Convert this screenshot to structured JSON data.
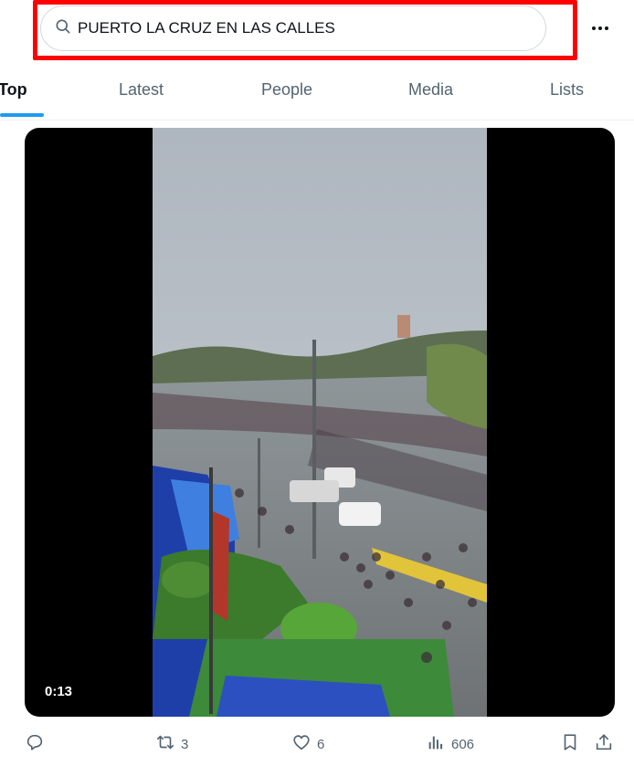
{
  "search": {
    "value": "PUERTO LA CRUZ EN LAS CALLES",
    "icon": "search-icon"
  },
  "header": {
    "more_icon": "more-horizontal-icon"
  },
  "tabs": [
    {
      "label": "Top",
      "active": true
    },
    {
      "label": "Latest",
      "active": false
    },
    {
      "label": "People",
      "active": false
    },
    {
      "label": "Media",
      "active": false
    },
    {
      "label": "Lists",
      "active": false
    }
  ],
  "post": {
    "video": {
      "duration": "0:13"
    },
    "actions": {
      "reply": {
        "icon": "reply-icon",
        "count": ""
      },
      "repost": {
        "icon": "repost-icon",
        "count": "3"
      },
      "like": {
        "icon": "heart-icon",
        "count": "6"
      },
      "views": {
        "icon": "analytics-icon",
        "count": "606"
      },
      "bookmark": {
        "icon": "bookmark-icon"
      },
      "share": {
        "icon": "share-icon"
      }
    }
  },
  "colors": {
    "accent": "#1d9bf0",
    "highlight_border": "#ff0000",
    "muted_text": "#536471"
  }
}
